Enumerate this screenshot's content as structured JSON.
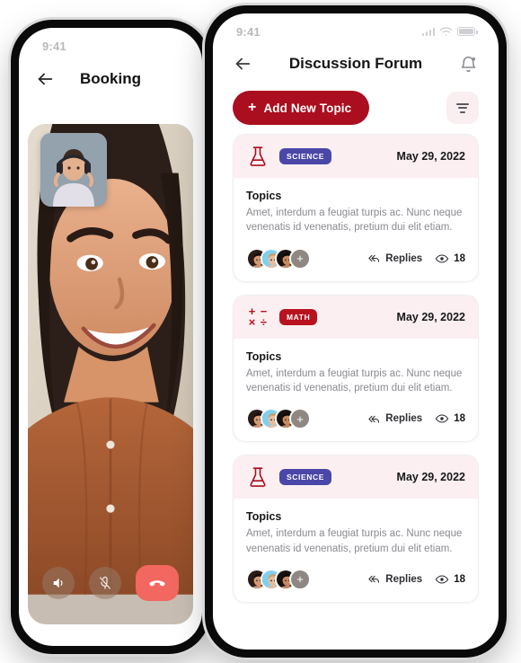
{
  "colors": {
    "brand_red": "#AB0E1E",
    "math_badge": "#B9121F",
    "science_badge": "#4A47A8",
    "card_header_bg": "#FBEFF1",
    "end_call_red": "#F2675F",
    "filter_bg": "#FBEEF0"
  },
  "back_phone": {
    "status": {
      "time": "9:41"
    },
    "header": {
      "back_icon": "arrow-left-icon",
      "title": "Booking"
    },
    "call": {
      "pip_label": "self-video-thumbnail",
      "controls": [
        {
          "name": "speaker-button",
          "icon": "speaker-icon"
        },
        {
          "name": "mute-button",
          "icon": "microphone-muted-icon"
        },
        {
          "name": "end-call-button",
          "icon": "phone-hangup-icon"
        }
      ]
    }
  },
  "front_phone": {
    "status": {
      "time": "9:41",
      "icons": [
        "signal-icon",
        "wifi-icon",
        "battery-icon"
      ]
    },
    "header": {
      "back_icon": "arrow-left-icon",
      "title": "Discussion Forum",
      "bell_icon": "notification-bell-icon"
    },
    "actions": {
      "add_label": "Add New Topic",
      "add_plus": "+",
      "filter_icon": "filter-icon"
    },
    "cards": [
      {
        "subject_icon": "flask-icon",
        "badge": "SCIENCE",
        "badge_color": "#4A47A8",
        "date": "May 29, 2022",
        "topic_label": "Topics",
        "description": "Amet, interdum a feugiat turpis ac. Nunc neque venenatis id venenatis, pretium dui elit etiam.",
        "avatar_more": "+",
        "replies_label": "Replies",
        "views": "18"
      },
      {
        "subject_icon": "math-symbols-icon",
        "badge": "MATH",
        "badge_color": "#B9121F",
        "date": "May 29, 2022",
        "topic_label": "Topics",
        "description": "Amet, interdum a feugiat turpis ac. Nunc neque venenatis id venenatis, pretium dui elit etiam.",
        "avatar_more": "+",
        "replies_label": "Replies",
        "views": "18"
      },
      {
        "subject_icon": "flask-icon",
        "badge": "SCIENCE",
        "badge_color": "#4A47A8",
        "date": "May 29, 2022",
        "topic_label": "Topics",
        "description": "Amet, interdum a feugiat turpis ac. Nunc neque venenatis id venenatis, pretium dui elit etiam.",
        "avatar_more": "+",
        "replies_label": "Replies",
        "views": "18"
      }
    ],
    "math_symbols": [
      "+",
      "−",
      "×",
      "÷"
    ]
  }
}
